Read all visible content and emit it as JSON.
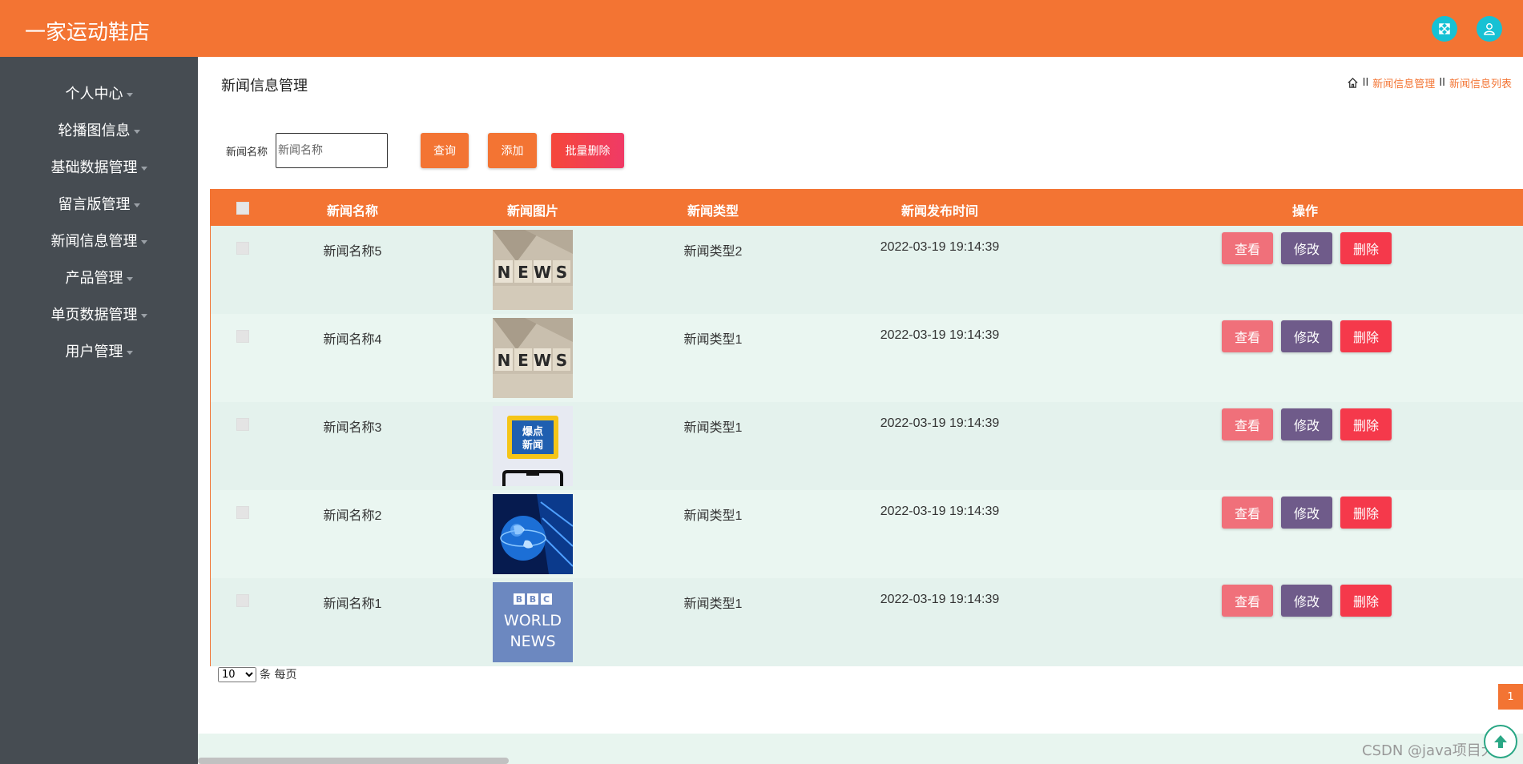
{
  "app": {
    "title": "一家运动鞋店"
  },
  "header": {
    "icons": [
      "fullscreen-icon",
      "user-icon"
    ]
  },
  "sidebar": {
    "items": [
      {
        "label": "个人中心"
      },
      {
        "label": "轮播图信息"
      },
      {
        "label": "基础数据管理"
      },
      {
        "label": "留言版管理"
      },
      {
        "label": "新闻信息管理"
      },
      {
        "label": "产品管理"
      },
      {
        "label": "单页数据管理"
      },
      {
        "label": "用户管理"
      }
    ]
  },
  "page": {
    "title": "新闻信息管理"
  },
  "breadcrumb": {
    "sep": "II",
    "items": [
      "新闻信息管理",
      "新闻信息列表"
    ]
  },
  "search": {
    "label": "新闻名称",
    "placeholder": "新闻名称",
    "query_label": "查询",
    "add_label": "添加",
    "batch_delete_label": "批量删除"
  },
  "table": {
    "headers": [
      "新闻名称",
      "新闻图片",
      "新闻类型",
      "新闻发布时间",
      "操作"
    ],
    "action_labels": {
      "view": "查看",
      "edit": "修改",
      "delete": "删除"
    },
    "rows": [
      {
        "name": "新闻名称5",
        "image": "news-blocks",
        "type": "新闻类型2",
        "time": "2022-03-19 19:14:39"
      },
      {
        "name": "新闻名称4",
        "image": "news-blocks",
        "type": "新闻类型1",
        "time": "2022-03-19 19:14:39"
      },
      {
        "name": "新闻名称3",
        "image": "hot-news-phone",
        "type": "新闻类型1",
        "time": "2022-03-19 19:14:39"
      },
      {
        "name": "新闻名称2",
        "image": "globe-broadcast",
        "type": "新闻类型1",
        "time": "2022-03-19 19:14:39"
      },
      {
        "name": "新闻名称1",
        "image": "bbc-world-news",
        "type": "新闻类型1",
        "time": "2022-03-19 19:14:39"
      }
    ]
  },
  "pagination": {
    "page_size": "10",
    "per_page_text": "条 每页",
    "current_page": "1"
  },
  "watermark": "CSDN @java项目大全",
  "colors": {
    "brand": "#f37433",
    "sidebar": "#464c52",
    "icon_circle": "#17c1d4",
    "row_even": "#e4f2ed",
    "row_odd": "#eaf6f1",
    "view_button": "#f0707a",
    "edit_button": "#6f5b8a",
    "delete_button": "#f5394b"
  }
}
